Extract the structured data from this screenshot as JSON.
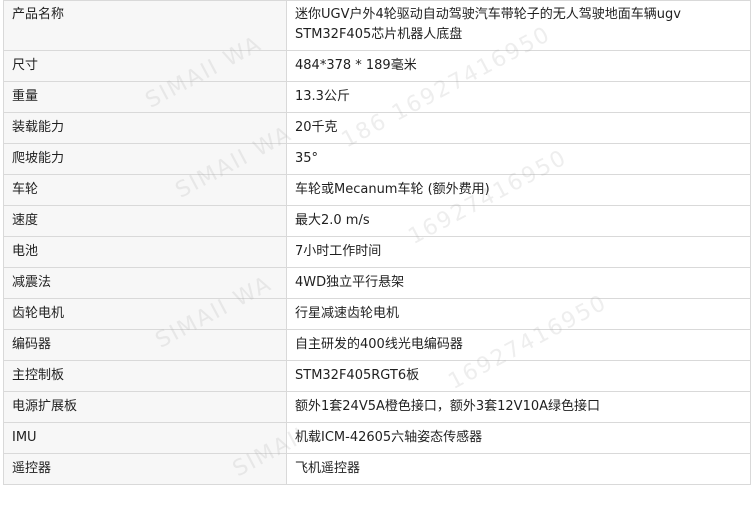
{
  "rows": [
    {
      "label": "产品名称",
      "value": "迷你UGV户外4轮驱动自动驾驶汽车带轮子的无人驾驶地面车辆ugv STM32F405芯片机器人底盘"
    },
    {
      "label": "尺寸",
      "value": "484*378 * 189毫米"
    },
    {
      "label": "重量",
      "value": "13.3公斤"
    },
    {
      "label": "装载能力",
      "value": "20千克"
    },
    {
      "label": "爬坡能力",
      "value": "35°"
    },
    {
      "label": "车轮",
      "value": "车轮或Mecanum车轮 (额外费用)"
    },
    {
      "label": "速度",
      "value": "最大2.0 m/s"
    },
    {
      "label": "电池",
      "value": "7小时工作时间"
    },
    {
      "label": "减震法",
      "value": "4WD独立平行悬架"
    },
    {
      "label": "齿轮电机",
      "value": "行星减速齿轮电机"
    },
    {
      "label": "编码器",
      "value": "自主研发的400线光电编码器"
    },
    {
      "label": "主控制板",
      "value": "STM32F405RGT6板"
    },
    {
      "label": "电源扩展板",
      "value": "额外1套24V5A橙色接口，额外3套12V10A绿色接口"
    },
    {
      "label": "IMU",
      "value": "机载ICM-42605六轴姿态传感器"
    },
    {
      "label": "遥控器",
      "value": "飞机遥控器"
    }
  ],
  "watermarks": [
    "SIMAII WA",
    "186 16927416950",
    "SIMAII WA",
    "16927416950",
    "SIMAII WA",
    "16927416950",
    "SIMAII"
  ]
}
